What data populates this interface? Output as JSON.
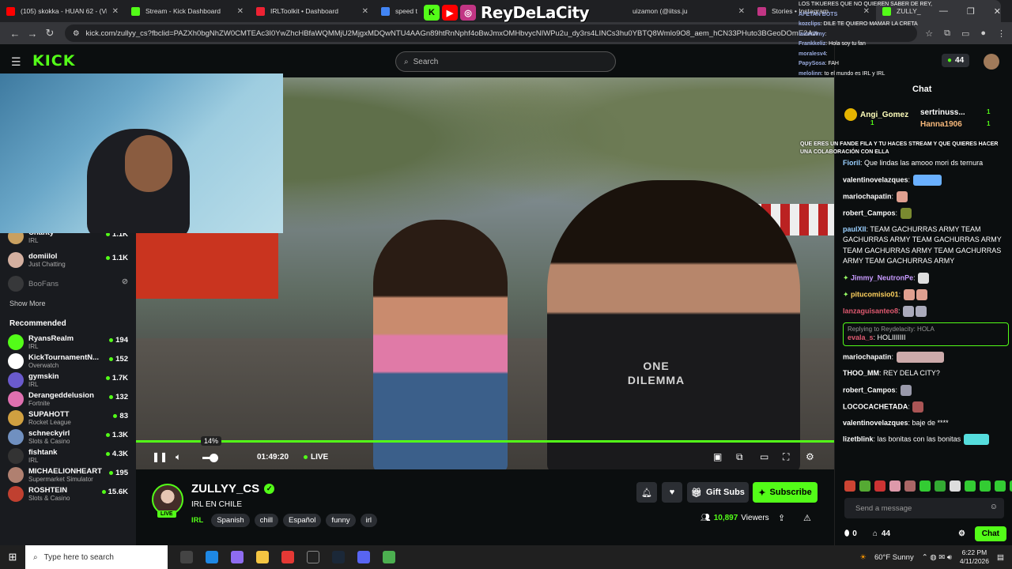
{
  "browser": {
    "tabs": [
      {
        "title": "(105) skokka - HUAN 62 - (Vid",
        "color": "#ff0000"
      },
      {
        "title": "Stream - Kick Dashboard",
        "color": "#53fc18"
      },
      {
        "title": "IRLToolkit • Dashboard",
        "color": "#e23"
      },
      {
        "title": "speed t",
        "color": "#4285f4"
      },
      {
        "title": "uizamon (@iitss.ju",
        "color": "#c13584"
      },
      {
        "title": "Stories • Instagram",
        "color": "#c13584"
      },
      {
        "title": "ZULLY_",
        "color": "#53fc18"
      }
    ],
    "url": "kick.com/zullyy_cs?fbclid=PAZXh0bgNhZW0CMTEAc3I0YwZhcHBfaWQMMjU2MjgxMDQwNTU4AAGn89htRnNphf4oBwJmxOMHbvycNIWPu2u_dy3rs4LINCs3hu0YBTQ8Wmlo9O8_aem_hCN33PHuto3BGeoDOmE2Aw"
  },
  "overlay": {
    "brand": "ReyDeLaCity",
    "ticker_lines": [
      {
        "user": "",
        "text": "LOS TIKUERES QUE NO QUIEREN SABER DE REY,"
      },
      {
        "user": "AFETAN BOTS",
        "text": ""
      },
      {
        "user": "kozclips",
        "text": ": DILE TE QUIERO MAMAR LA CRETA"
      },
      {
        "user": "iamwillmy",
        "text": ":"
      },
      {
        "user": "Frankkeliz",
        "text": ": Hola soy tu fan"
      },
      {
        "user": "moralesv4",
        "text": ":"
      },
      {
        "user": "PapySosa",
        "text": ": FAH"
      },
      {
        "user": "melolinn",
        "text": ": to el mundo es IRL y IRL"
      }
    ],
    "question": "QUE ERES UN FANDE FILA Y TU HACES STREAM Y QUE QUIERES HACER UNA COLABORACIÓN CON ELLA"
  },
  "kick": {
    "logo": "KICK",
    "search_placeholder": "Search"
  },
  "sidebar": {
    "following": [
      {
        "name": "Chanty",
        "category": "IRL",
        "count": "1.1K",
        "color": "#c9a060"
      },
      {
        "name": "domiilol",
        "category": "Just Chatting",
        "count": "1.1K",
        "color": "#d4b0a0"
      },
      {
        "name": "BooFans",
        "category": "",
        "count": "",
        "color": "#555"
      }
    ],
    "show_more": "Show More",
    "recommended_heading": "Recommended",
    "recommended": [
      {
        "name": "RyansRealm",
        "category": "IRL",
        "count": "194",
        "color": "#53fc18"
      },
      {
        "name": "KickTournamentN...",
        "category": "Overwatch",
        "count": "152",
        "color": "#fff"
      },
      {
        "name": "gymskin",
        "category": "IRL",
        "count": "1.7K",
        "color": "#6a5acd"
      },
      {
        "name": "Derangeddelusion",
        "category": "Fortnite",
        "count": "132",
        "color": "#e070b0"
      },
      {
        "name": "SUPAHOTT",
        "category": "Rocket League",
        "count": "83",
        "color": "#d0a040"
      },
      {
        "name": "schneckyirl",
        "category": "Slots & Casino",
        "count": "1.3K",
        "color": "#7090c0"
      },
      {
        "name": "fishtank",
        "category": "IRL",
        "count": "4.3K",
        "color": "#333"
      },
      {
        "name": "MICHAELIONHEART",
        "category": "Supermarket Simulator",
        "count": "195",
        "color": "#b08070"
      },
      {
        "name": "ROSHTEIN",
        "category": "Slots & Casino",
        "count": "15.6K",
        "color": "#c04030"
      }
    ]
  },
  "player": {
    "volume_tip": "14%",
    "volume_level": 0.14,
    "elapsed": "01:49:20",
    "live_label": "LIVE",
    "shirt_text": "ONE DILEMMA"
  },
  "stream": {
    "name": "ZULLYY_CS",
    "title": "IRL EN CHILE",
    "category": "IRL",
    "tags": [
      "Spanish",
      "chill",
      "Español",
      "funny",
      "irl"
    ],
    "gift_label": "Gift Subs",
    "subscribe_label": "Subscribe",
    "viewers": "10,897",
    "viewers_label": "Viewers",
    "live_badge": "LIVE"
  },
  "chat": {
    "viewer_count": "44",
    "title": "Chat",
    "leaderboard": [
      {
        "name": "Angi_Gomez",
        "value": "1"
      },
      {
        "name": "sertrinuss...",
        "value": "1"
      },
      {
        "name": "Hanna1906",
        "value": "1"
      }
    ],
    "messages": [
      {
        "user": "Fioril",
        "text": ": Que lindas las amooo mori ds ternura",
        "color": "#9ad0ff"
      },
      {
        "user": "valentinovelazques",
        "text": ":",
        "color": "#fff"
      },
      {
        "user": "mariochapatin",
        "text": ":",
        "color": "#fff"
      },
      {
        "user": "robert_Campos",
        "text": ":",
        "color": "#fff"
      },
      {
        "user": "paulXII",
        "text": ": TEAM GACHURRAS ARMY TEAM GACHURRAS ARMY TEAM GACHURRAS ARMY TEAM GACHURRAS ARMY TEAM GACHURRAS ARMY TEAM GACHURRAS ARMY",
        "color": "#9ad0ff"
      },
      {
        "user": "Jimmy_NeutronPe",
        "text": ":",
        "color": "#c89bff"
      },
      {
        "user": "pitucomisio01",
        "text": ":",
        "color": "#ffd25e"
      },
      {
        "user": "lanzaguisanteo8",
        "text": ":",
        "color": "#e05a70"
      },
      {
        "user": "mariochapatin",
        "text": ":",
        "color": "#fff"
      },
      {
        "user": "THOO_MM",
        "text": ": REY DELA CITY?",
        "color": "#fff"
      },
      {
        "user": "robert_Campos",
        "text": ":",
        "color": "#fff"
      },
      {
        "user": "LOCOCACHETADA",
        "text": ":",
        "color": "#fff"
      },
      {
        "user": "valentinovelazques",
        "text": ": baje de ****",
        "color": "#fff"
      },
      {
        "user": "lizetblink",
        "text": ": las bonitas con las bonitas",
        "color": "#fff"
      }
    ],
    "reply": {
      "to": "Replying to Reydelacity: HOLA",
      "user": "evala_s",
      "text": ": HOLIIIIIII"
    },
    "send_placeholder": "Send a message",
    "footer_left": "0",
    "footer_count": "44",
    "chat_button": "Chat"
  },
  "taskbar": {
    "search_placeholder": "Type here to search",
    "weather": "60°F Sunny",
    "time": "6:22 PM",
    "date": "4/11/2026"
  }
}
